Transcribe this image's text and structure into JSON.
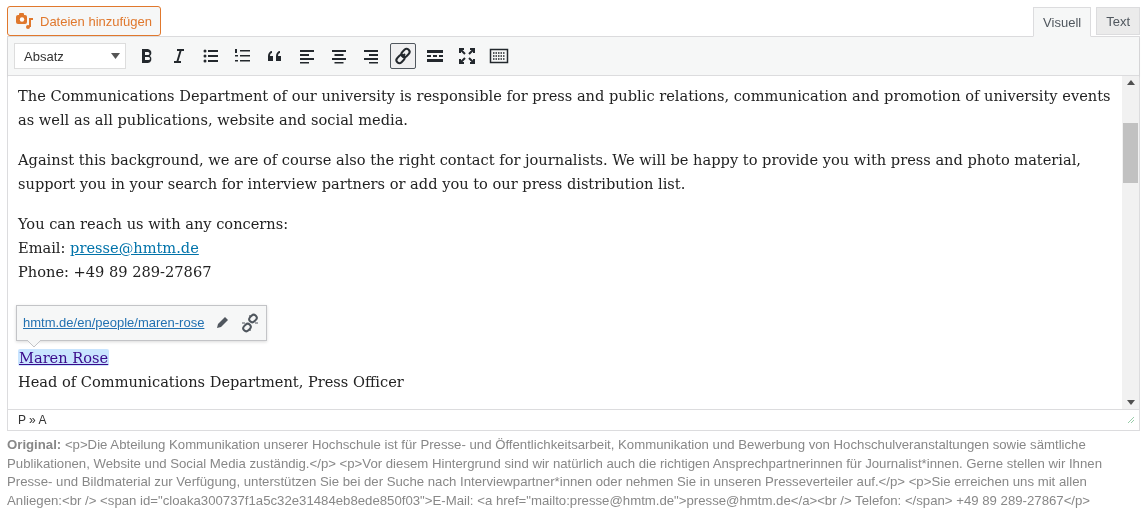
{
  "add_media_button": {
    "label": "Dateien hinzufügen"
  },
  "tabs": [
    {
      "label": "Visuell",
      "selected": true
    },
    {
      "label": "Text",
      "selected": false
    }
  ],
  "toolbar": {
    "format_select": {
      "value": "Absatz"
    },
    "buttons": [
      {
        "kind": "bold",
        "active": false
      },
      {
        "kind": "italic",
        "active": false
      },
      {
        "kind": "bullet-list",
        "active": false
      },
      {
        "kind": "numbered-list",
        "active": false
      },
      {
        "kind": "quote",
        "active": false
      },
      {
        "kind": "align-left",
        "active": false
      },
      {
        "kind": "align-center",
        "active": false
      },
      {
        "kind": "align-right",
        "active": false
      },
      {
        "kind": "link",
        "active": true
      },
      {
        "kind": "read-more",
        "active": false
      },
      {
        "kind": "fullscreen",
        "active": false
      },
      {
        "kind": "toolbar-toggle",
        "active": false
      }
    ]
  },
  "content": {
    "paragraphs": [
      "The Communications Department of our university is responsible for press and public relations, communication and promotion of university events as well as all publications, website and social media.",
      "Against this background, we are of course also the right contact for journalists. We will be happy to provide you with press and photo material, support you in your search for interview partners or add you to our press distribution list."
    ],
    "contact": {
      "intro": "You can reach us with any concerns:",
      "email_label": "Email:",
      "email": "presse@hmtm.de",
      "phone": "Phone:  +49 89 289-27867"
    },
    "link_popup": {
      "url": "hmtm.de/en/people/maren-rose"
    },
    "person_link": "Maren Rose",
    "person_title": "Head of Communications Department, Press Officer"
  },
  "status_path": "P » A",
  "original_note": "**Original:** <p>Die Abteilung Kommunikation unserer Hochschule ist für Presse- und Öffentlichkeitsarbeit, Kommunikation und Bewerbung von Hochschulveranstaltungen sowie sämtliche Publikationen, Website und Social Media zuständig.</p> <p>Vor diesem Hintergrund sind wir natürlich auch die richtigen Ansprechpartnerinnen für Journalist*innen. Gerne stellen wir Ihnen Presse- und Bildmaterial zur Verfügung, unterstützen Sie bei der Suche nach Interviewpartner*innen oder nehmen Sie in unseren Presseverteiler auf.</p> <p>Sie erreichen uns mit allen Anliegen:<br /> <span id=\"cloaka300737f1a5c32e31484eb8ede850f03\">E-Mail: <a href=\"mailto:presse@hmtm.de\">presse@hmtm.de</a><br /> Telefon: </span> +49 89 289-27867</p>"
}
